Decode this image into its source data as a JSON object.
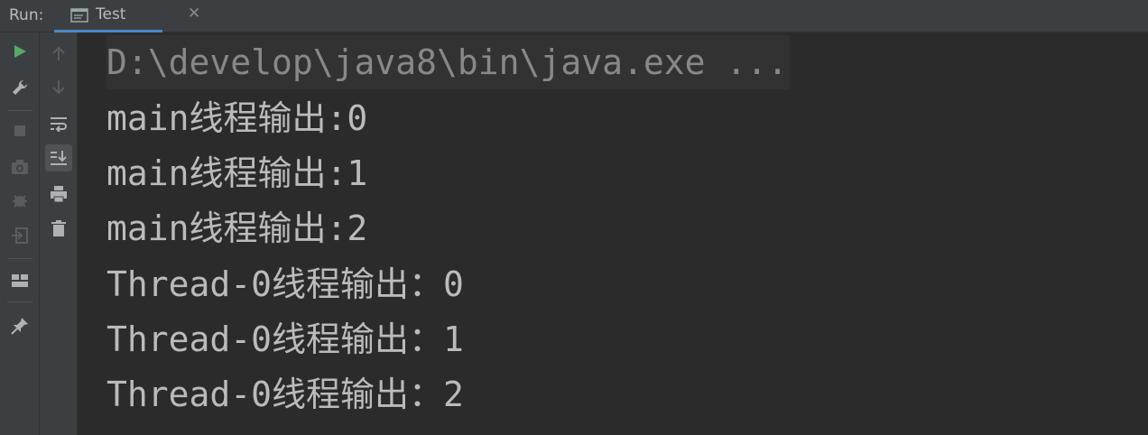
{
  "tabbar": {
    "run_label": "Run:",
    "tab_label": "Test",
    "close_glyph": "✕"
  },
  "toolbar": {
    "outer_icons": [
      "run-icon",
      "wrench-icon",
      "stop-icon",
      "camera-icon",
      "debug-icon",
      "exit-icon",
      "layout-icon",
      "pin-icon"
    ],
    "inner_icons": [
      "arrow-up-icon",
      "arrow-down-icon",
      "soft-wrap-icon",
      "scroll-to-end-icon",
      "print-icon",
      "trash-icon"
    ]
  },
  "console": {
    "command_line": "D:\\develop\\java8\\bin\\java.exe ...",
    "lines": [
      "main线程输出:0",
      "main线程输出:1",
      "main线程输出:2",
      "Thread-0线程输出：0",
      "Thread-0线程输出：1",
      "Thread-0线程输出：2"
    ]
  },
  "colors": {
    "background": "#2b2b2b",
    "panel": "#3c3f41",
    "text": "#bbbbbb",
    "run_green": "#59a869",
    "tab_underline": "#4a88c7"
  }
}
